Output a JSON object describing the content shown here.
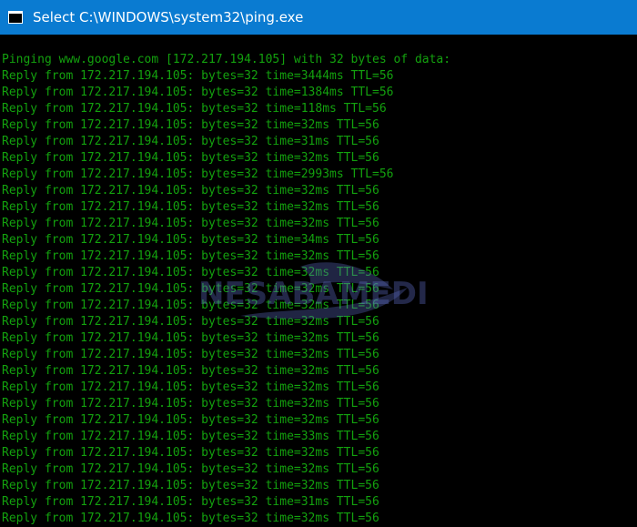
{
  "window": {
    "title": "Select C:\\WINDOWS\\system32\\ping.exe",
    "titlebar_color": "#0a7bd1",
    "console_background": "#000000",
    "text_color": "#13a10e",
    "icon": "console-window-icon"
  },
  "console": {
    "lines": [
      "Pinging www.google.com [172.217.194.105] with 32 bytes of data:",
      "Reply from 172.217.194.105: bytes=32 time=3444ms TTL=56",
      "Reply from 172.217.194.105: bytes=32 time=1384ms TTL=56",
      "Reply from 172.217.194.105: bytes=32 time=118ms TTL=56",
      "Reply from 172.217.194.105: bytes=32 time=32ms TTL=56",
      "Reply from 172.217.194.105: bytes=32 time=31ms TTL=56",
      "Reply from 172.217.194.105: bytes=32 time=32ms TTL=56",
      "Reply from 172.217.194.105: bytes=32 time=2993ms TTL=56",
      "Reply from 172.217.194.105: bytes=32 time=32ms TTL=56",
      "Reply from 172.217.194.105: bytes=32 time=32ms TTL=56",
      "Reply from 172.217.194.105: bytes=32 time=32ms TTL=56",
      "Reply from 172.217.194.105: bytes=32 time=34ms TTL=56",
      "Reply from 172.217.194.105: bytes=32 time=32ms TTL=56",
      "Reply from 172.217.194.105: bytes=32 time=32ms TTL=56",
      "Reply from 172.217.194.105: bytes=32 time=32ms TTL=56",
      "Reply from 172.217.194.105: bytes=32 time=32ms TTL=56",
      "Reply from 172.217.194.105: bytes=32 time=32ms TTL=56",
      "Reply from 172.217.194.105: bytes=32 time=32ms TTL=56",
      "Reply from 172.217.194.105: bytes=32 time=32ms TTL=56",
      "Reply from 172.217.194.105: bytes=32 time=32ms TTL=56",
      "Reply from 172.217.194.105: bytes=32 time=32ms TTL=56",
      "Reply from 172.217.194.105: bytes=32 time=32ms TTL=56",
      "Reply from 172.217.194.105: bytes=32 time=32ms TTL=56",
      "Reply from 172.217.194.105: bytes=32 time=33ms TTL=56",
      "Reply from 172.217.194.105: bytes=32 time=32ms TTL=56",
      "Reply from 172.217.194.105: bytes=32 time=32ms TTL=56",
      "Reply from 172.217.194.105: bytes=32 time=32ms TTL=56",
      "Reply from 172.217.194.105: bytes=32 time=31ms TTL=56",
      "Reply from 172.217.194.105: bytes=32 time=32ms TTL=56"
    ]
  },
  "watermark": {
    "text": "NESABAMEDIA",
    "icon": "nesabamedia-logo-icon",
    "color": "#5c6bc0"
  }
}
